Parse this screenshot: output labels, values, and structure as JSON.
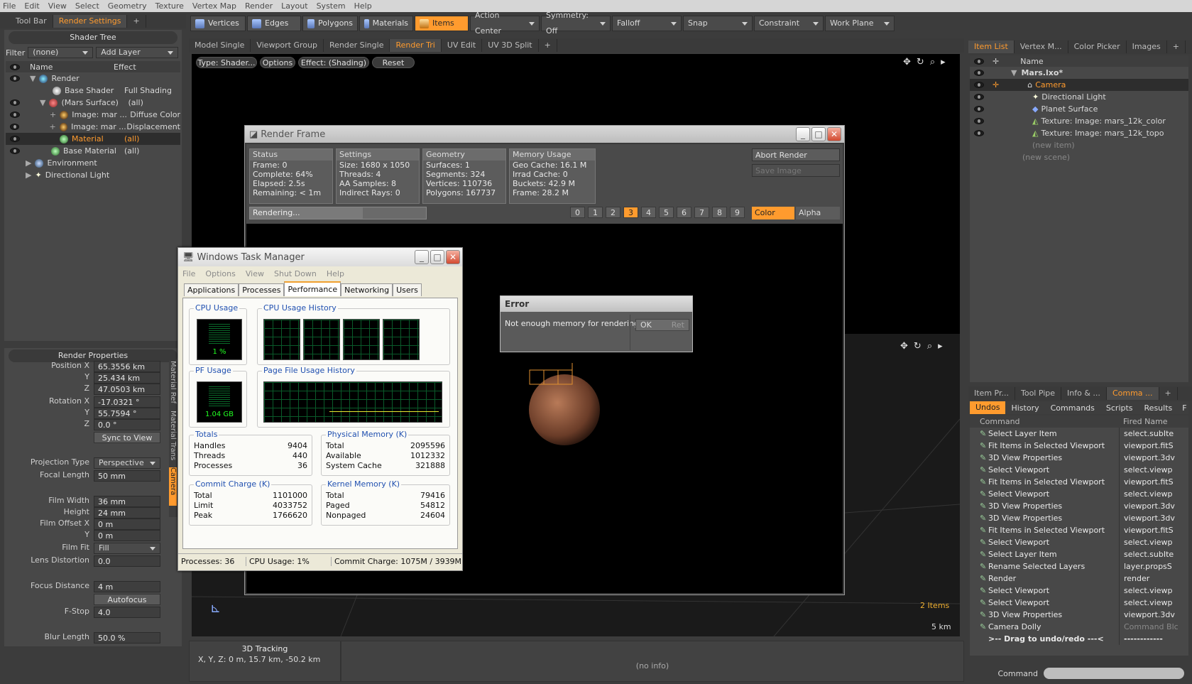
{
  "menubar": [
    "File",
    "Edit",
    "View",
    "Select",
    "Geometry",
    "Texture",
    "Vertex Map",
    "Render",
    "Layout",
    "System",
    "Help"
  ],
  "layout_tabs": [
    "Tool Bar",
    "Render Settings",
    "+"
  ],
  "mode_buttons": [
    "Vertices",
    "Edges",
    "Polygons",
    "Materials",
    "Items"
  ],
  "action_center": "Action Center",
  "symmetry": "Symmetry: Off",
  "falloff": "Falloff",
  "snap": "Snap",
  "constraint": "Constraint",
  "work_plane": "Work Plane",
  "view_tabs": [
    "Model Single",
    "Viewport Group",
    "Render Single",
    "Render Tri",
    "UV Edit",
    "UV 3D Split",
    "+"
  ],
  "shader_tree": {
    "title": "Shader Tree",
    "filter_label": "Filter",
    "filter_value": "(none)",
    "add_layer": "Add Layer",
    "col_name": "Name",
    "col_effect": "Effect",
    "rows": [
      {
        "name": "Render",
        "effect": ""
      },
      {
        "name": "Base Shader",
        "effect": "Full Shading"
      },
      {
        "name": "(Mars Surface)",
        "effect": "(all)"
      },
      {
        "name": "Image: mar ...",
        "effect": "Diffuse Color"
      },
      {
        "name": "Image: mar ...",
        "effect": "Displacement"
      },
      {
        "name": "Material",
        "effect": "(all)"
      },
      {
        "name": "Base Material",
        "effect": "(all)"
      },
      {
        "name": "Environment",
        "effect": ""
      },
      {
        "name": "Directional Light",
        "effect": ""
      }
    ]
  },
  "render_props": {
    "title": "Render Properties",
    "position_label": "Position X",
    "pos": [
      "65.3556 km",
      "25.434 km",
      "47.0503 km"
    ],
    "rotation_label": "Rotation X",
    "rot": [
      "-17.0321 °",
      "55.7594 °",
      "0.0 °"
    ],
    "y": "Y",
    "z": "Z",
    "sync": "Sync to View",
    "projection_label": "Projection Type",
    "projection": "Perspective",
    "focal_label": "Focal Length",
    "focal": "50 mm",
    "film_width_label": "Film Width",
    "film_width": "36 mm",
    "height_label": "Height",
    "height": "24 mm",
    "film_offset_label": "Film Offset X",
    "offx": "0 m",
    "offy": "0 m",
    "film_fit_label": "Film Fit",
    "film_fit": "Fill",
    "lens_label": "Lens Distortion",
    "lens": "0.0",
    "focus_label": "Focus Distance",
    "focus": "4 m",
    "autofocus": "Autofocus",
    "fstop_label": "F-Stop",
    "fstop": "4.0",
    "blur_label": "Blur Length",
    "blur": "50.0 %",
    "side_tabs": [
      "Material Ref",
      "Material Trans",
      "Camera"
    ]
  },
  "viewport_toolbar": [
    "Type: Shader...",
    "Options",
    "Effect: (Shading)",
    "Reset"
  ],
  "render_frame": {
    "title": "Render Frame",
    "status": {
      "h": "Status",
      "lines": [
        "Frame: 0",
        "Complete: 64%",
        "Elapsed: 2.5s",
        "Remaining: < 1m"
      ]
    },
    "settings": {
      "h": "Settings",
      "lines": [
        "Size: 1680 x 1050",
        "Threads: 4",
        "AA Samples: 8",
        "Indirect Rays: 0"
      ]
    },
    "geometry": {
      "h": "Geometry",
      "lines": [
        "Surfaces: 1",
        "Segments: 324",
        "Vertices: 110736",
        "Polygons: 167737"
      ]
    },
    "memory": {
      "h": "Memory Usage",
      "lines": [
        "Geo Cache: 16.1 M",
        "Irrad Cache: 0",
        "Buckets: 42.9 M",
        "Frame: 28.2 M"
      ]
    },
    "abort": "Abort Render",
    "save": "Save Image",
    "progress": "Rendering...",
    "progress_value": 0.64,
    "frames": [
      "0",
      "1",
      "2",
      "3",
      "4",
      "5",
      "6",
      "7",
      "8",
      "9"
    ],
    "selected_frame": "3",
    "color": "Color",
    "alpha": "Alpha"
  },
  "error": {
    "title": "Error",
    "message": "Not enough memory for rendering.",
    "ok": "OK",
    "ret": "Ret"
  },
  "task_manager": {
    "title": "Windows Task Manager",
    "menu": [
      "File",
      "Options",
      "View",
      "Shut Down",
      "Help"
    ],
    "tabs": [
      "Applications",
      "Processes",
      "Performance",
      "Networking",
      "Users"
    ],
    "cpu_usage": "CPU Usage",
    "cpu_value": "1 %",
    "cpu_history": "CPU Usage History",
    "pf_usage": "PF Usage",
    "pf_value": "1.04 GB",
    "pf_history": "Page File Usage History",
    "totals": {
      "h": "Totals",
      "rows": [
        [
          "Handles",
          "9404"
        ],
        [
          "Threads",
          "440"
        ],
        [
          "Processes",
          "36"
        ]
      ]
    },
    "physical": {
      "h": "Physical Memory (K)",
      "rows": [
        [
          "Total",
          "2095596"
        ],
        [
          "Available",
          "1012332"
        ],
        [
          "System Cache",
          "321888"
        ]
      ]
    },
    "commit": {
      "h": "Commit Charge (K)",
      "rows": [
        [
          "Total",
          "1101000"
        ],
        [
          "Limit",
          "4033752"
        ],
        [
          "Peak",
          "1766620"
        ]
      ]
    },
    "kernel": {
      "h": "Kernel Memory (K)",
      "rows": [
        [
          "Total",
          "79416"
        ],
        [
          "Paged",
          "54812"
        ],
        [
          "Nonpaged",
          "24604"
        ]
      ]
    },
    "status": [
      "Processes: 36",
      "CPU Usage: 1%",
      "Commit Charge: 1075M / 3939M"
    ]
  },
  "viewport_bottom": {
    "items": "2 Items",
    "scale": "5 km"
  },
  "tracking": {
    "title": "3D Tracking",
    "xyz": "X, Y, Z:   0 m, 15.7 km, -50.2 km",
    "info": "(no info)"
  },
  "item_list": {
    "tabs": [
      "Item List",
      "Vertex M...",
      "Color Picker",
      "Images",
      "+"
    ],
    "col_name": "Name",
    "rows": [
      "Mars.lxo*",
      "Camera",
      "Directional Light",
      "Planet Surface",
      "Texture: Image: mars_12k_color",
      "Texture: Image: mars_12k_topo",
      "(new item)",
      "(new scene)"
    ]
  },
  "bottom_right": {
    "tabs": [
      "Item Pr...",
      "Tool Pipe",
      "Info & ...",
      "Comma ...",
      "+"
    ],
    "subtabs": [
      "Undos",
      "History",
      "Commands",
      "Scripts",
      "Results",
      "F"
    ],
    "col_cmd": "Command",
    "col_fired": "Fired Name",
    "rows": [
      [
        "Select Layer Item",
        "select.subIte"
      ],
      [
        "Fit Items in Selected Viewport",
        "viewport.fitS"
      ],
      [
        "3D View Properties",
        "viewport.3dv"
      ],
      [
        "Select Viewport",
        "select.viewp"
      ],
      [
        "Fit Items in Selected Viewport",
        "viewport.fitS"
      ],
      [
        "Select Viewport",
        "select.viewp"
      ],
      [
        "3D View Properties",
        "viewport.3dv"
      ],
      [
        "3D View Properties",
        "viewport.3dv"
      ],
      [
        "Fit Items in Selected Viewport",
        "viewport.fitS"
      ],
      [
        "Select Viewport",
        "select.viewp"
      ],
      [
        "Select Layer Item",
        "select.subIte"
      ],
      [
        "Rename Selected Layers",
        "layer.propsS"
      ],
      [
        "Render",
        "render"
      ],
      [
        "Select Viewport",
        "select.viewp"
      ],
      [
        "Select Viewport",
        "select.viewp"
      ],
      [
        "3D View Properties",
        "viewport.3dv"
      ],
      [
        "Camera Dolly",
        "Command Blc"
      ],
      [
        ">-- Drag to undo/redo ---<",
        "------------"
      ]
    ],
    "command_label": "Command"
  }
}
